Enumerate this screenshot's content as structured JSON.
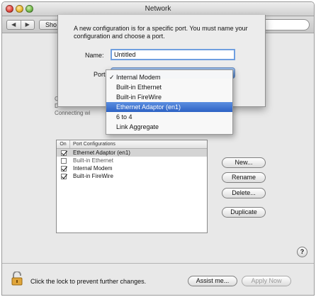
{
  "window": {
    "title": "Network"
  },
  "toolbar": {
    "back": "◀",
    "forward": "▶",
    "show_all": "Sho"
  },
  "background": {
    "line1": "Cli",
    "line2": "D",
    "line3": "Connecting wi"
  },
  "sheet": {
    "message": "A new configuration is for a specific port. You must name your configuration and choose a port.",
    "name_label": "Name:",
    "name_value": "Untitled",
    "port_label": "Port",
    "port_menu": [
      {
        "label": "Internal Modem",
        "checked": true,
        "highlighted": false
      },
      {
        "label": "Built-in Ethernet",
        "checked": false,
        "highlighted": false
      },
      {
        "label": "Built-in FireWire",
        "checked": false,
        "highlighted": false
      },
      {
        "label": "Ethernet Adaptor (en1)",
        "checked": false,
        "highlighted": true
      },
      {
        "label": "6 to 4",
        "checked": false,
        "highlighted": false
      },
      {
        "label": "Link Aggregate",
        "checked": false,
        "highlighted": false
      }
    ],
    "check_glyph": "✓"
  },
  "ports_list": {
    "col_on": "On",
    "col_name": "Port Configurations",
    "rows": [
      {
        "label": "Ethernet Adaptor (en1)",
        "on": true,
        "selected": true
      },
      {
        "label": "Built-in Ethernet",
        "on": false,
        "selected": false
      },
      {
        "label": "Internal Modem",
        "on": true,
        "selected": false
      },
      {
        "label": "Built-in FireWire",
        "on": true,
        "selected": false
      }
    ]
  },
  "buttons": {
    "new": "New...",
    "rename": "Rename",
    "delete": "Delete...",
    "duplicate": "Duplicate",
    "assist": "Assist me...",
    "apply": "Apply Now",
    "help": "?"
  },
  "footer": {
    "lock_text": "Click the lock to prevent further changes."
  },
  "colors": {
    "accent": "#2d62c4",
    "lock": "#e0a53a"
  }
}
